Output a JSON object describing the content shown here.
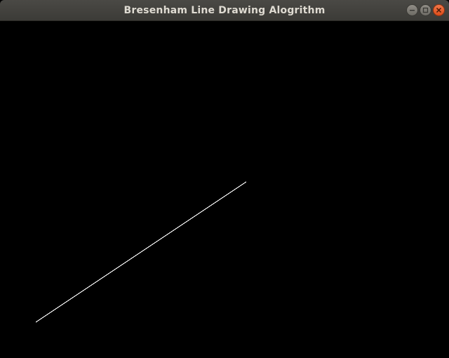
{
  "window": {
    "title": "Bresenham Line Drawing Alogrithm"
  },
  "controls": {
    "minimize_icon": "minimize-icon",
    "maximize_icon": "maximize-icon",
    "close_icon": "close-icon"
  },
  "colors": {
    "background": "#000000",
    "line": "#ffffff",
    "titlebar": "#3c3b37",
    "close_button": "#e95420"
  }
}
